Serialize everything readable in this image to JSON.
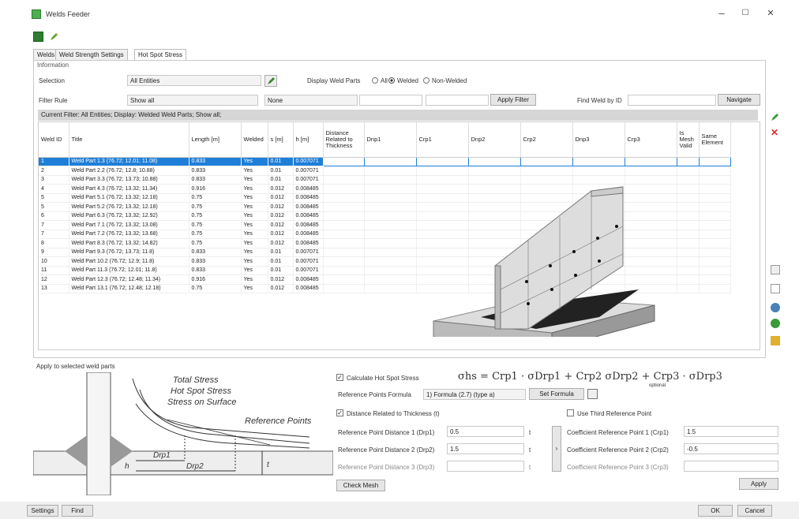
{
  "window": {
    "title": "Welds Feeder",
    "minimize": "–",
    "maximize": "☐",
    "close": "✕"
  },
  "tabs": [
    "Welds",
    "Weld Strength Settings",
    "Hot Spot Stress"
  ],
  "info": {
    "group": "Information",
    "selection_label": "Selection",
    "selection_value": "All Entities",
    "filter_rule_label": "Filter Rule",
    "filter_rule_value": "Show all",
    "none_value": "None",
    "display_label": "Display Weld Parts",
    "opt_all": "All",
    "opt_welded": "Welded",
    "opt_nonwelded": "Non-Welded",
    "apply_filter": "Apply Filter",
    "find_label": "Find Weld by ID",
    "navigate": "Navigate"
  },
  "filter_bar": "Current Filter: All Entities; Display: Welded Weld Parts; Show all;",
  "columns": [
    "Weld ID",
    "Title",
    "Length [m]",
    "Welded",
    "s [m]",
    "h [m]",
    "Distance Related to Thickness",
    "Dnp1",
    "Crp1",
    "Dnp2",
    "Crp2",
    "Dnp3",
    "Crp3",
    "Is Mesh Valid",
    "Same Element"
  ],
  "rows": [
    [
      "1",
      "Weld Part 1.3 (76.72; 12.01; 11.08)",
      "0.833",
      "Yes",
      "0.01",
      "0.007071"
    ],
    [
      "2",
      "Weld Part 2.2 (76.72; 12.8; 10.88)",
      "0.833",
      "Yes",
      "0.01",
      "0.007071"
    ],
    [
      "3",
      "Weld Part 3.3 (76.72; 13.73; 10.88)",
      "0.833",
      "Yes",
      "0.01",
      "0.007071"
    ],
    [
      "4",
      "Weld Part 4.3 (76.72; 13.32; 11.34)",
      "0.916",
      "Yes",
      "0.012",
      "0.008485"
    ],
    [
      "5",
      "Weld Part 5.1 (76.72; 13.32; 12.18)",
      "0.75",
      "Yes",
      "0.012",
      "0.008485"
    ],
    [
      "5",
      "Weld Part 5.2 (76.72; 13.32; 12.18)",
      "0.75",
      "Yes",
      "0.012",
      "0.008485"
    ],
    [
      "6",
      "Weld Part 6.3 (76.72; 13.32; 12.92)",
      "0.75",
      "Yes",
      "0.012",
      "0.008485"
    ],
    [
      "7",
      "Weld Part 7.1 (76.72; 13.32; 13.08)",
      "0.75",
      "Yes",
      "0.012",
      "0.008485"
    ],
    [
      "7",
      "Weld Part 7.2 (76.72; 13.32; 13.68)",
      "0.75",
      "Yes",
      "0.012",
      "0.008485"
    ],
    [
      "8",
      "Weld Part 8.3 (76.72; 13.32; 14.82)",
      "0.75",
      "Yes",
      "0.012",
      "0.008485"
    ],
    [
      "9",
      "Weld Part 9.3 (76.72; 13.73; 11.8)",
      "0.833",
      "Yes",
      "0.01",
      "0.007071"
    ],
    [
      "10",
      "Weld Part 10.2 (76.72; 12.9; 11.8)",
      "0.833",
      "Yes",
      "0.01",
      "0.007071"
    ],
    [
      "11",
      "Weld Part 11.3 (76.72; 12.01; 11.8)",
      "0.833",
      "Yes",
      "0.01",
      "0.007071"
    ],
    [
      "12",
      "Weld Part 12.3 (76.72; 12.48; 11.34)",
      "0.916",
      "Yes",
      "0.012",
      "0.008485"
    ],
    [
      "13",
      "Weld Part 13.1 (76.72; 12.48; 12.18)",
      "0.75",
      "Yes",
      "0.012",
      "0.008485"
    ]
  ],
  "diagram": {
    "apply_label": "Apply to selected weld parts",
    "total": "Total Stress",
    "hotspot": "Hot Spot Stress",
    "surface": "Stress on Surface",
    "refpoints": "Reference Points",
    "drp1": "Drp1",
    "drp2": "Drp2",
    "h": "h",
    "t": "t"
  },
  "hss": {
    "calc_label": "Calculate Hot Spot Stress",
    "formula_text": "σhs = Crp1 · σDrp1 + Crp2 σDrp2 + Crp3 · σDrp3",
    "formula_note": "optional",
    "ref_formula_label": "Reference Points Formula",
    "ref_formula_value": "1) Formula (2.7) (type a)",
    "set_formula": "Set Formula",
    "dist_rel_label": "Distance Related to Thickness (t)",
    "third_label": "Use Third Reference Point",
    "rpd1_label": "Reference Point Distance 1 (Drp1)",
    "rpd1": "0.5",
    "rpd2_label": "Reference Point Distance 2 (Drp2)",
    "rpd2": "1.5",
    "rpd3_label": "Reference Point Distance 3 (Drp3)",
    "rpd3": "",
    "t": "t",
    "coef1_label": "Coefficient Reference Point 1 (Crp1)",
    "coef1": "1.5",
    "coef2_label": "Coefficient Reference Point 2 (Crp2)",
    "coef2": "-0.5",
    "coef3_label": "Coefficient Reference Point 3 (Crp3)",
    "coef3": "",
    "check_mesh": "Check Mesh",
    "apply": "Apply",
    "arrow": "›"
  },
  "status": {
    "settings": "Settings",
    "find": "Find",
    "ok": "OK",
    "cancel": "Cancel"
  },
  "colors": {
    "accent": "#1f7fd8",
    "green": "#3a9a3a",
    "red": "#d9302c"
  }
}
